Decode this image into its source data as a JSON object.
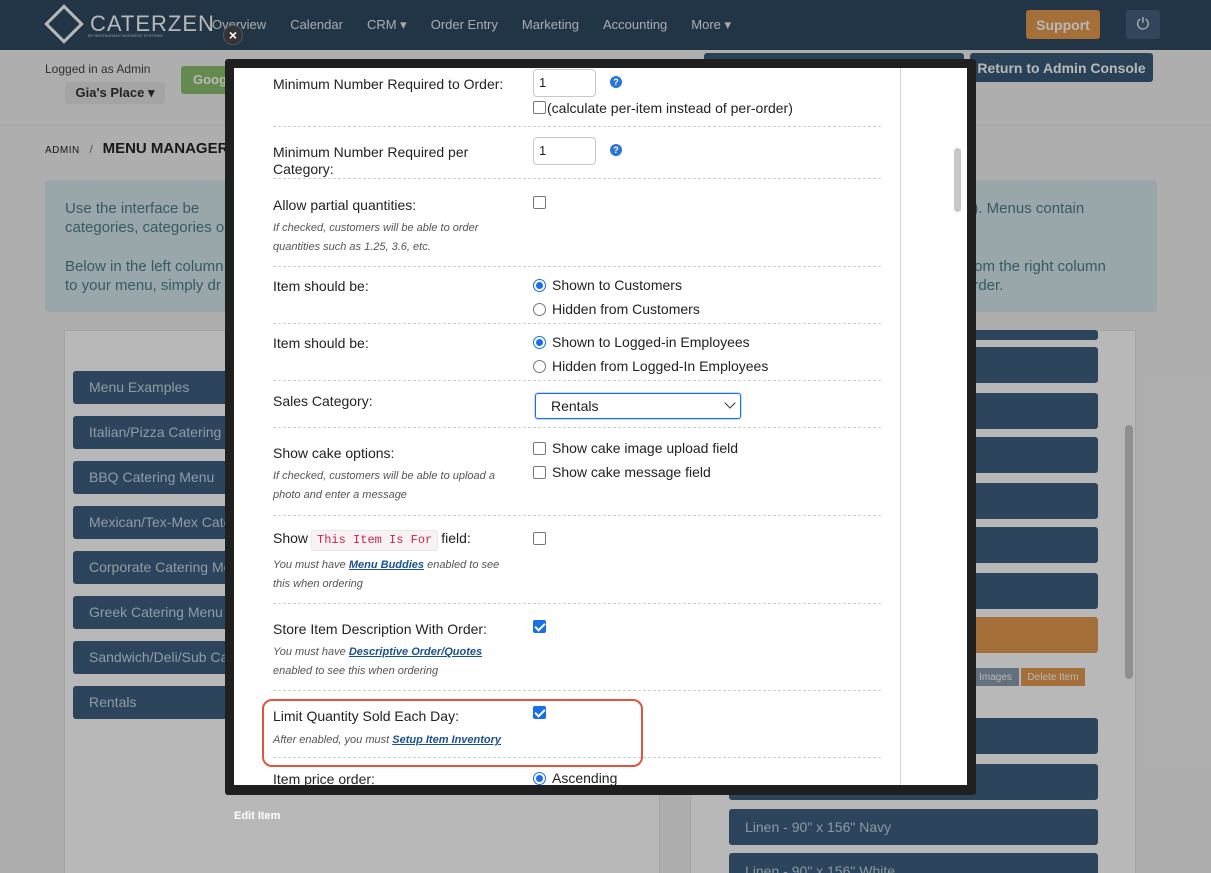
{
  "topnav": {
    "brand": "CATERZEN",
    "brand_sub": "BY RESTAURANT BUSINESS SYSTEMS",
    "items": [
      "Overview",
      "Calendar",
      "CRM ▾",
      "Order Entry",
      "Marketing",
      "Accounting",
      "More ▾"
    ],
    "support": "Support",
    "power_icon": "⏻"
  },
  "subbar": {
    "logged_in": "Logged in as Admin",
    "store": "Gia's Place ▾",
    "google": "Goog",
    "return": "Return to Admin Console"
  },
  "breadcrumb": {
    "root": "ADMIN",
    "sep": "/",
    "current": "MENU MANAGER"
  },
  "info": {
    "l1": "Use the interface be categories, categories o",
    "l2": "Below in the left column to your menu, simply dr",
    "r1": "g). Menus contain",
    "r2": "from the right column",
    "r3": "order."
  },
  "left_menus": [
    "Menu Examples",
    "Italian/Pizza Catering M",
    "BBQ Catering Menu",
    "Mexican/Tex-Mex Cate",
    "Corporate Catering Me",
    "Greek Catering Menu",
    "Sandwich/Deli/Sub Ca",
    "Rentals"
  ],
  "right_items": {
    "img_tag": "Images",
    "del_tag": "Delete Item",
    "bar1": "Linen - 90\" x 156\" Navy",
    "bar2": "Linen - 90\" x 156\" White"
  },
  "modal": {
    "caption": "Edit Item",
    "close": "×",
    "fields": {
      "min_order": {
        "label": "Minimum Number Required to Order:",
        "value": "1",
        "per_item": "(calculate per-item instead of per-order)"
      },
      "min_category": {
        "label": "Minimum Number Required per Category:",
        "value": "1"
      },
      "partial": {
        "label": "Allow partial quantities:",
        "help": "If checked, customers will be able to order quantities such as 1.25, 3.6, etc."
      },
      "customers": {
        "label": "Item should be:",
        "opt1": "Shown to Customers",
        "opt2": "Hidden from Customers"
      },
      "employees": {
        "label": "Item should be:",
        "opt1": "Shown to Logged-in Employees",
        "opt2": "Hidden from Logged-In Employees"
      },
      "sales_cat": {
        "label": "Sales Category:",
        "value": "Rentals"
      },
      "cake": {
        "label": "Show cake options:",
        "help": "If checked, customers will be able to upload a photo and enter a message",
        "opt1": "Show cake image upload field",
        "opt2": "Show cake message field"
      },
      "item_for": {
        "label_pre": "Show",
        "code": "This Item Is For",
        "label_post": "field:",
        "help_pre": "You must have",
        "help_link": "Menu Buddies",
        "help_post": "enabled to see this when ordering"
      },
      "store_desc": {
        "label": "Store Item Description With Order:",
        "help_pre": "You must have",
        "help_link": "Descriptive Order/Quotes",
        "help_post": "enabled to see this when ordering"
      },
      "limit_qty": {
        "label": "Limit Quantity Sold Each Day:",
        "help_pre": "After enabled, you must",
        "help_link": "Setup Item Inventory"
      },
      "price_order": {
        "label": "Item price order:",
        "opt1": "Ascending"
      }
    }
  },
  "colors": {
    "nav": "#2f4a62",
    "accent": "#1a6ee8",
    "highlight": "#e0553d",
    "support": "#e49a4e"
  }
}
